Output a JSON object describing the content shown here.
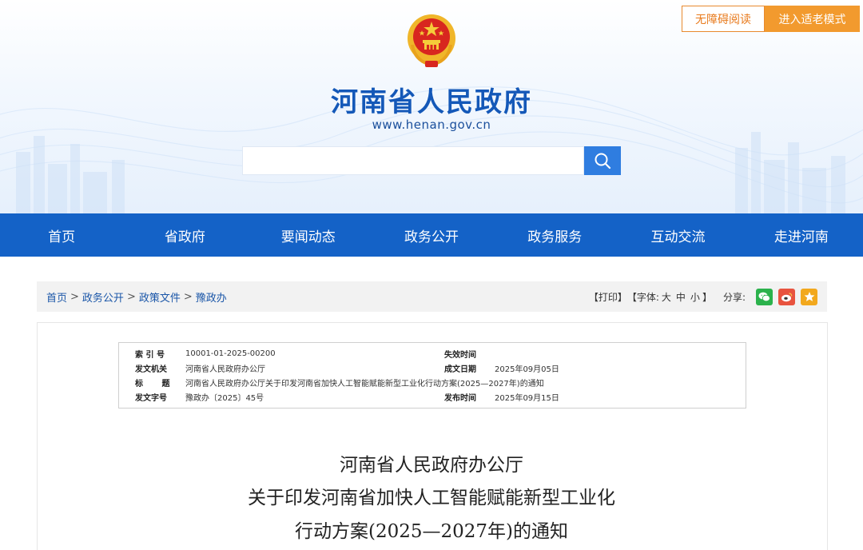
{
  "top_buttons": {
    "accessible_label": "无障碍阅读",
    "elder_mode_label": "进入适老模式"
  },
  "site": {
    "title": "河南省人民政府",
    "url": "www.henan.gov.cn"
  },
  "search": {
    "placeholder": ""
  },
  "nav": {
    "items": [
      "首页",
      "省政府",
      "要闻动态",
      "政务公开",
      "政务服务",
      "互动交流",
      "走进河南"
    ]
  },
  "breadcrumb": {
    "items": [
      "首页",
      "政务公开",
      "政策文件",
      "豫政办"
    ],
    "separator": ">"
  },
  "tools": {
    "print": "【打印】",
    "font_prefix": "【字体:",
    "size_large": "大",
    "size_medium": "中",
    "size_small": "小",
    "font_suffix": "】",
    "share_label": "分享:",
    "share_icons": [
      "wechat-icon",
      "weibo-icon",
      "favorite-icon"
    ]
  },
  "meta": {
    "index_label": "索 引 号",
    "index_value": "10001-01-2025-00200",
    "expiry_label": "失效时间",
    "expiry_value": "",
    "issuer_label": "发文机关",
    "issuer_value": "河南省人民政府办公厅",
    "created_label": "成文日期",
    "created_value": "2025年09月05日",
    "title_label": "标 题",
    "title_value": "河南省人民政府办公厅关于印发河南省加快人工智能赋能新型工业化行动方案(2025—2027年)的通知",
    "docno_label": "发文字号",
    "docno_value": "豫政办〔2025〕45号",
    "published_label": "发布时间",
    "published_value": "2025年09月15日"
  },
  "document": {
    "title_line1": "河南省人民政府办公厅",
    "title_line2": "关于印发河南省加快人工智能赋能新型工业化",
    "title_line3": "行动方案(2025—2027年)的通知"
  },
  "colors": {
    "brand_blue": "#1462c7",
    "title_blue": "#1458b8",
    "accent_orange": "#f29a2e"
  }
}
